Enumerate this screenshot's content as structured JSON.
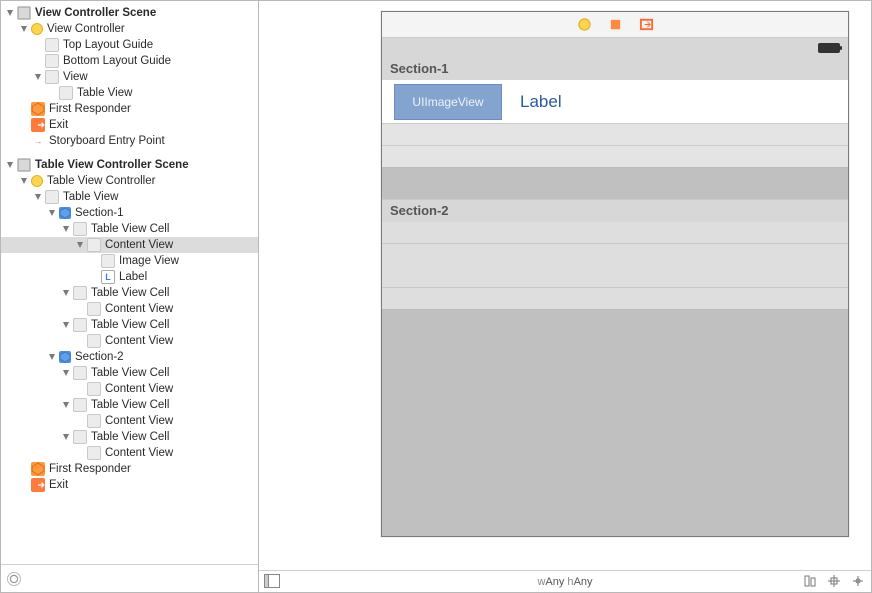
{
  "tree": [
    {
      "depth": 0,
      "bold": true,
      "open": true,
      "icon": "scene",
      "label": "View Controller Scene"
    },
    {
      "depth": 1,
      "open": true,
      "icon": "vc",
      "label": "View Controller"
    },
    {
      "depth": 2,
      "leaf": true,
      "icon": "view",
      "label": "Top Layout Guide"
    },
    {
      "depth": 2,
      "leaf": true,
      "icon": "view",
      "label": "Bottom Layout Guide"
    },
    {
      "depth": 2,
      "open": true,
      "icon": "view",
      "label": "View"
    },
    {
      "depth": 3,
      "leaf": true,
      "icon": "view",
      "label": "Table View"
    },
    {
      "depth": 1,
      "leaf": true,
      "icon": "cube",
      "label": "First Responder"
    },
    {
      "depth": 1,
      "leaf": true,
      "icon": "exit",
      "label": "Exit"
    },
    {
      "depth": 1,
      "leaf": true,
      "icon": "arrow",
      "label": "Storyboard Entry Point"
    },
    {
      "depth": 0,
      "bold": true,
      "open": true,
      "icon": "scene",
      "label": "Table View Controller Scene",
      "spaceBefore": true
    },
    {
      "depth": 1,
      "open": true,
      "icon": "vc",
      "label": "Table View Controller"
    },
    {
      "depth": 2,
      "open": true,
      "icon": "view",
      "label": "Table View"
    },
    {
      "depth": 3,
      "open": true,
      "icon": "sect",
      "label": "Section-1"
    },
    {
      "depth": 4,
      "open": true,
      "icon": "view",
      "label": "Table View Cell"
    },
    {
      "depth": 5,
      "open": true,
      "icon": "view",
      "label": "Content View",
      "selected": true
    },
    {
      "depth": 6,
      "leaf": true,
      "icon": "view",
      "label": "Image View"
    },
    {
      "depth": 6,
      "leaf": true,
      "icon": "label",
      "label": "Label"
    },
    {
      "depth": 4,
      "open": true,
      "icon": "view",
      "label": "Table View Cell"
    },
    {
      "depth": 5,
      "leaf": true,
      "icon": "view",
      "label": "Content View"
    },
    {
      "depth": 4,
      "open": true,
      "icon": "view",
      "label": "Table View Cell"
    },
    {
      "depth": 5,
      "leaf": true,
      "icon": "view",
      "label": "Content View"
    },
    {
      "depth": 3,
      "open": true,
      "icon": "sect",
      "label": "Section-2"
    },
    {
      "depth": 4,
      "open": true,
      "icon": "view",
      "label": "Table View Cell"
    },
    {
      "depth": 5,
      "leaf": true,
      "icon": "view",
      "label": "Content View"
    },
    {
      "depth": 4,
      "open": true,
      "icon": "view",
      "label": "Table View Cell"
    },
    {
      "depth": 5,
      "leaf": true,
      "icon": "view",
      "label": "Content View"
    },
    {
      "depth": 4,
      "open": true,
      "icon": "view",
      "label": "Table View Cell"
    },
    {
      "depth": 5,
      "leaf": true,
      "icon": "view",
      "label": "Content View"
    },
    {
      "depth": 1,
      "leaf": true,
      "icon": "cube",
      "label": "First Responder"
    },
    {
      "depth": 1,
      "leaf": true,
      "icon": "exit",
      "label": "Exit"
    }
  ],
  "filter": {
    "placeholder": ""
  },
  "preview": {
    "section1": "Section-1",
    "section2": "Section-2",
    "uiimage": "UIImageView",
    "label": "Label"
  },
  "footer": {
    "sizeclass_w_label": "w",
    "sizeclass_w": "Any",
    "sizeclass_h_label": " h",
    "sizeclass_h": "Any"
  }
}
